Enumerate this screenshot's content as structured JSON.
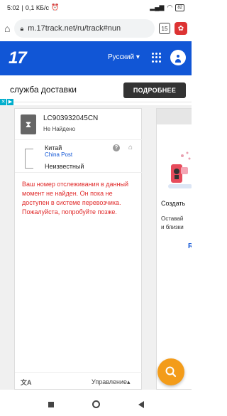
{
  "status_bar": {
    "time": "5:02",
    "speed": "0,1 КБ/с",
    "battery": "82"
  },
  "browser": {
    "url": "m.17track.net/ru/track#nun",
    "tab_count": "15"
  },
  "header": {
    "logo": "17",
    "language": "Русский ▾"
  },
  "ad": {
    "text": "служба доставки",
    "button": "ПОДРОБНЕЕ"
  },
  "tracking": {
    "number": "LC903932045CN",
    "status": "Не Найдено",
    "origin_country": "Китай",
    "carrier": "China Post",
    "destination": "Неизвестный",
    "message": "Ваш номер отслеживания в данный момент не найден. Он пока не доступен в системе перевозчика. Пожалуйста, попробуйте позже.",
    "manage_label": "Управление▴"
  },
  "side_panel": {
    "create_text": "Создать",
    "sub_text_1": "Оставай",
    "sub_text_2": "и близки",
    "link": "R"
  },
  "colors": {
    "brand_blue": "#1156d6",
    "error_red": "#e02a2a",
    "fab_orange": "#f39c1a"
  }
}
